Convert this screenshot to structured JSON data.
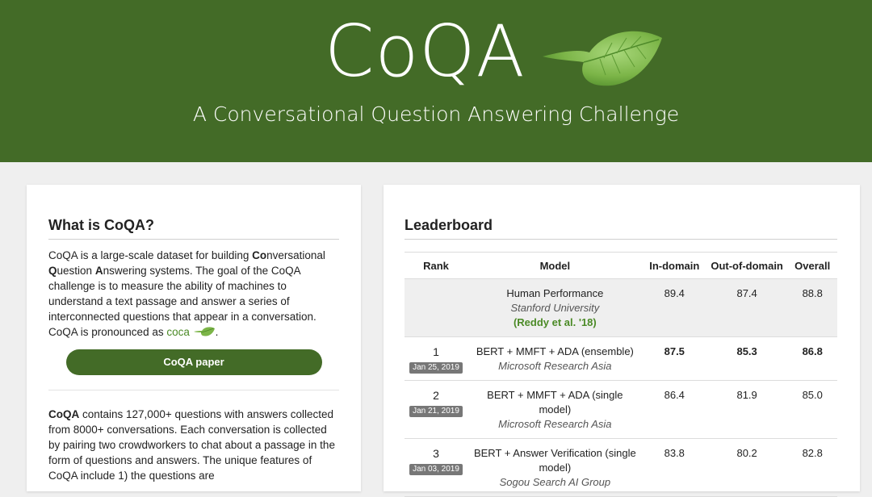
{
  "header": {
    "title": "CoQA",
    "subtitle": "A Conversational Question Answering Challenge",
    "bg_color": "#436b27"
  },
  "about": {
    "heading": "What is CoQA?",
    "para1_segments": [
      {
        "text": "CoQA is a large-scale dataset for building ",
        "bold": false
      },
      {
        "text": "Co",
        "bold": true
      },
      {
        "text": "nversational ",
        "bold": false
      },
      {
        "text": "Q",
        "bold": true
      },
      {
        "text": "uestion ",
        "bold": false
      },
      {
        "text": "A",
        "bold": true
      },
      {
        "text": "nswering systems. The goal of the CoQA challenge is to measure the ability of machines to understand a text passage and answer a series of interconnected questions that appear in a conversation. CoQA is pronounced as ",
        "bold": false
      }
    ],
    "coca_word": "coca",
    "period": ".",
    "paper_button": "CoQA paper",
    "para2_lead": "CoQA",
    "para2_rest": " contains 127,000+ questions with answers collected from 8000+ conversations. Each conversation is collected by pairing two crowdworkers to chat about a passage in the form of questions and answers. The unique features of CoQA include 1) the questions are"
  },
  "leaderboard": {
    "heading": "Leaderboard",
    "columns": [
      "Rank",
      "Model",
      "In-domain",
      "Out-of-domain",
      "Overall"
    ],
    "human": {
      "model": "Human Performance",
      "institution": "Stanford University",
      "reference": "(Reddy et al. '18)",
      "in_domain": "89.4",
      "out_domain": "87.4",
      "overall": "88.8"
    },
    "rows": [
      {
        "rank": "1",
        "date": "Jan 25, 2019",
        "model": "BERT + MMFT + ADA (ensemble)",
        "institution": "Microsoft Research Asia",
        "in_domain": "87.5",
        "out_domain": "85.3",
        "overall": "86.8",
        "bold": true
      },
      {
        "rank": "2",
        "date": "Jan 21, 2019",
        "model": "BERT + MMFT + ADA (single model)",
        "institution": "Microsoft Research Asia",
        "in_domain": "86.4",
        "out_domain": "81.9",
        "overall": "85.0",
        "bold": false
      },
      {
        "rank": "3",
        "date": "Jan 03, 2019",
        "model": "BERT + Answer Verification (single model)",
        "institution": "Sogou Search AI Group",
        "in_domain": "83.8",
        "out_domain": "80.2",
        "overall": "82.8",
        "bold": false
      }
    ]
  }
}
